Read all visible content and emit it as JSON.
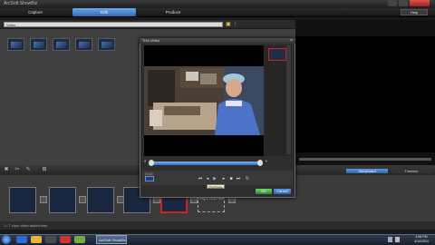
{
  "window": {
    "title": "ArcSoft ShowBiz"
  },
  "tabs": [
    {
      "label": "Capture"
    },
    {
      "label": "Edit"
    },
    {
      "label": "Produce"
    }
  ],
  "toolbar": {
    "help_label": "Help"
  },
  "library": {
    "path_value": "Video",
    "clip_count": 6
  },
  "dialog": {
    "title": "Trim Video",
    "time_label": "00:00",
    "tooltip": "Play/Pause",
    "ok_label": "OK",
    "cancel_label": "Cancel"
  },
  "view_toggle": {
    "storyboard_label": "Storyboard",
    "timeline_label": "Timeline"
  },
  "storyboard": {
    "drop_slot_text": "Drag & Drop Here",
    "status_text": "1 / 7 clips  video  added time"
  },
  "taskbar": {
    "app_label": "ArcSoft ShowBiz",
    "clock_time": "4:06 PM",
    "clock_date": "4/10/2010"
  },
  "colors": {
    "accent": "#2f6bb8",
    "selection": "#d02020",
    "confirm": "#2e8a2e"
  }
}
